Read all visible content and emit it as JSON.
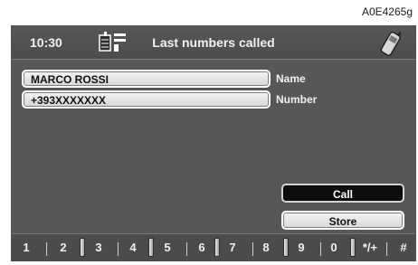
{
  "figure_code": "A0E4265g",
  "header": {
    "time": "10:30",
    "title": "Last numbers called",
    "left_icon": "call-list-icon",
    "right_icon": "mobile-phone-icon"
  },
  "fields": {
    "name_value": "MARCO ROSSI",
    "name_label": "Name",
    "number_value": "+393XXXXXXX",
    "number_label": "Number"
  },
  "buttons": {
    "call": "Call",
    "store": "Store"
  },
  "keypad": {
    "keys": [
      "1",
      "2",
      "3",
      "4",
      "5",
      "6",
      "7",
      "8",
      "9",
      "0",
      "*/+",
      "#"
    ]
  },
  "colors": {
    "screen_bg": "#575757",
    "text_light": "#f0f0f0",
    "field_bg": "#e8e8e8",
    "call_bg": "#0d0d0d"
  }
}
